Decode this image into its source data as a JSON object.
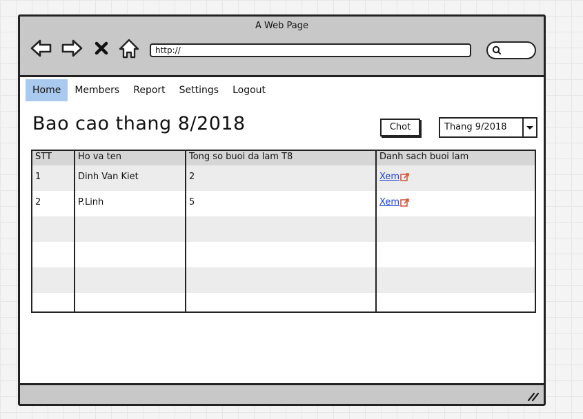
{
  "window": {
    "title": "A Web Page"
  },
  "toolbar": {
    "url": "http://",
    "icons": [
      "back-arrow-icon",
      "forward-arrow-icon",
      "close-x-icon",
      "home-icon",
      "search-icon"
    ]
  },
  "menu": {
    "items": [
      {
        "label": "Home",
        "active": true
      },
      {
        "label": "Members",
        "active": false
      },
      {
        "label": "Report",
        "active": false
      },
      {
        "label": "Settings",
        "active": false
      },
      {
        "label": "Logout",
        "active": false
      }
    ]
  },
  "page": {
    "title": "Bao cao thang 8/2018",
    "chot_label": "Chot",
    "month_select": "Thang 9/2018"
  },
  "table": {
    "headers": [
      "STT",
      "Ho va ten",
      "Tong so buoi da lam T8",
      "Danh sach buoi lam"
    ],
    "rows": [
      {
        "stt": "1",
        "name": "Dinh Van Kiet",
        "count": "2",
        "link": "Xem"
      },
      {
        "stt": "2",
        "name": "P.Linh",
        "count": "5",
        "link": "Xem"
      }
    ]
  },
  "colors": {
    "chrome": "#c8c8c8",
    "active_menu": "#a9c9ee",
    "link": "#1b3fd1",
    "row_alt": "#ececec",
    "header_bg": "#d6d6d6"
  }
}
